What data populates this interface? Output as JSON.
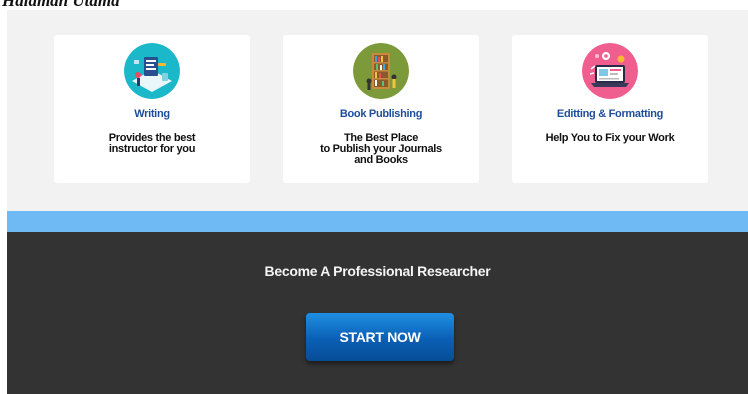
{
  "header": {
    "partial_text": "Halaman Utama"
  },
  "services": [
    {
      "title": "Writing",
      "description": "Provides the best\ninstructor for you",
      "icon": "writing-illustration-icon",
      "icon_color": "#1ab8c9"
    },
    {
      "title": "Book Publishing",
      "description": "The Best Place\nto Publish your Journals\nand Books",
      "icon": "bookshelf-illustration-icon",
      "icon_color": "#7c9a3a"
    },
    {
      "title": "Editting & Formatting",
      "description": "Help You to Fix your Work",
      "icon": "laptop-editing-illustration-icon",
      "icon_color": "#f05e8f"
    }
  ],
  "cta": {
    "heading": "Become A Professional Researcher",
    "button_label": "START NOW"
  },
  "colors": {
    "accent_blue": "#6fbaf5",
    "title_blue": "#1e4d9a",
    "dark_bg": "#333333",
    "button_blue": "#0a5fb5"
  }
}
